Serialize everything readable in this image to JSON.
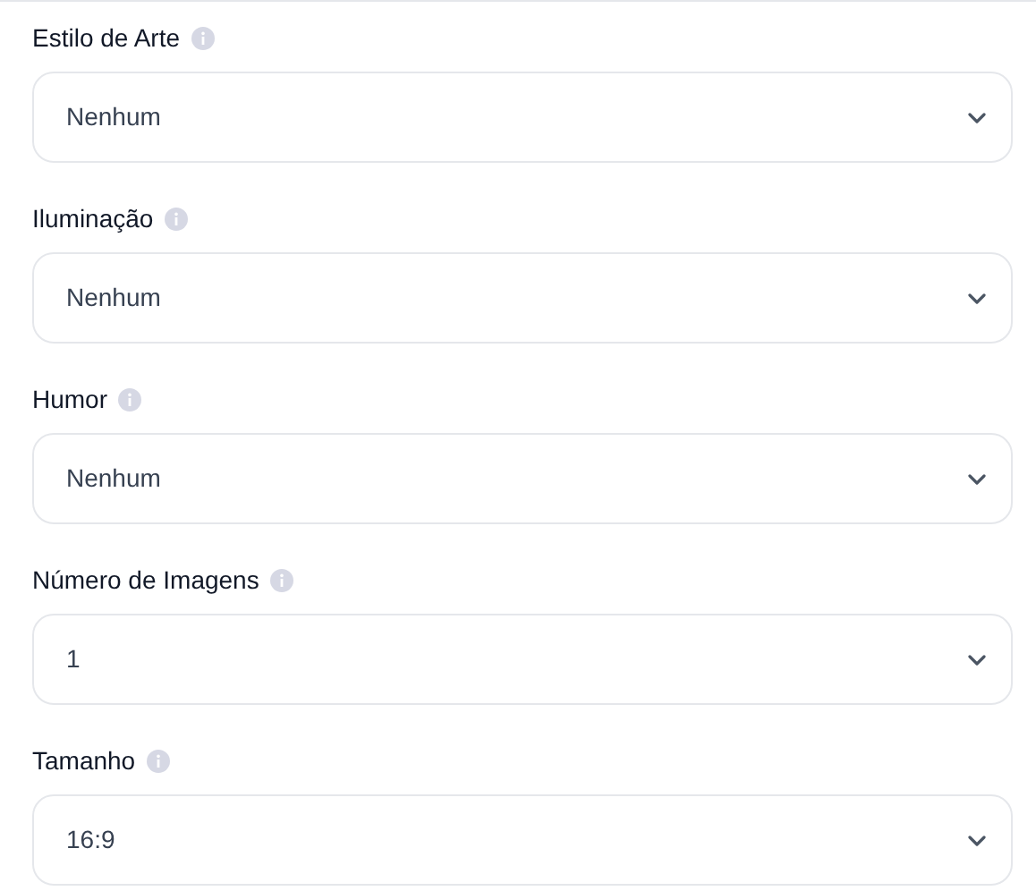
{
  "fields": [
    {
      "label": "Estilo de Arte",
      "value": "Nenhum"
    },
    {
      "label": "Iluminação",
      "value": "Nenhum"
    },
    {
      "label": "Humor",
      "value": "Nenhum"
    },
    {
      "label": "Número de Imagens",
      "value": "1"
    },
    {
      "label": "Tamanho",
      "value": "16:9"
    }
  ]
}
